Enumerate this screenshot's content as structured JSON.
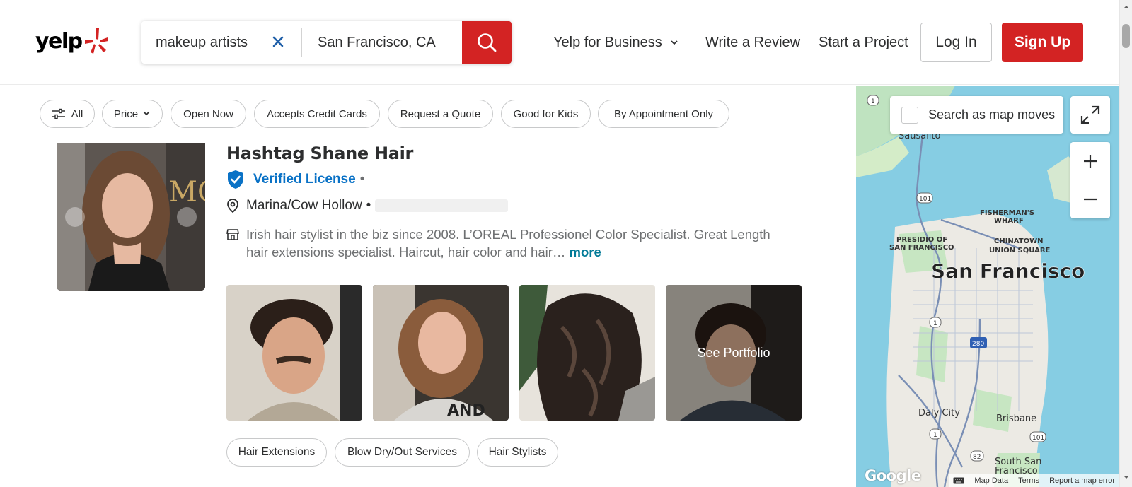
{
  "header": {
    "logo_text": "yelp",
    "search": {
      "what_value": "makeup artists",
      "where_value": "San Francisco, CA"
    },
    "nav": {
      "business": "Yelp for Business",
      "review": "Write a Review",
      "project": "Start a Project"
    },
    "login": "Log In",
    "signup": "Sign Up"
  },
  "filters": [
    {
      "label": "All"
    },
    {
      "label": "Price"
    },
    {
      "label": "Open Now"
    },
    {
      "label": "Accepts Credit Cards"
    },
    {
      "label": "Request a Quote"
    },
    {
      "label": "Good for Kids"
    },
    {
      "label": "By Appointment Only"
    }
  ],
  "listing": {
    "name": "Hashtag Shane Hair",
    "verified": "Verified License",
    "verified_sep": "•",
    "neighborhood": "Marina/Cow Hollow",
    "neighborhood_sep": "•",
    "description": "Irish hair stylist in the biz since 2008. L’OREAL Professionel Color Specialist. Great Length hair extensions specialist. Haircut, hair color and hair…",
    "more": "more",
    "portfolio_label": "See Portfolio",
    "tags": [
      "Hair Extensions",
      "Blow Dry/Out Services",
      "Hair Stylists"
    ]
  },
  "map": {
    "search_as_moves": "Search as map moves",
    "labels": {
      "sausalito": "Sausalito",
      "fishermans": "FISHERMAN'S",
      "wharf": "WHARF",
      "presidio1": "PRESIDIO OF",
      "presidio2": "SAN FRANCISCO",
      "chinatown": "CHINATOWN",
      "union": "UNION SQUARE",
      "city": "San Francisco",
      "daly": "Daly City",
      "brisbane": "Brisbane",
      "southsan1": "South San",
      "southsan2": "Francisco"
    },
    "footer": {
      "data": "Map Data",
      "terms": "Terms",
      "report": "Report a map error"
    },
    "google": "Google"
  },
  "colors": {
    "brand_red": "#d32323",
    "verified_blue": "#0a72c6",
    "link_teal": "#027a97"
  }
}
